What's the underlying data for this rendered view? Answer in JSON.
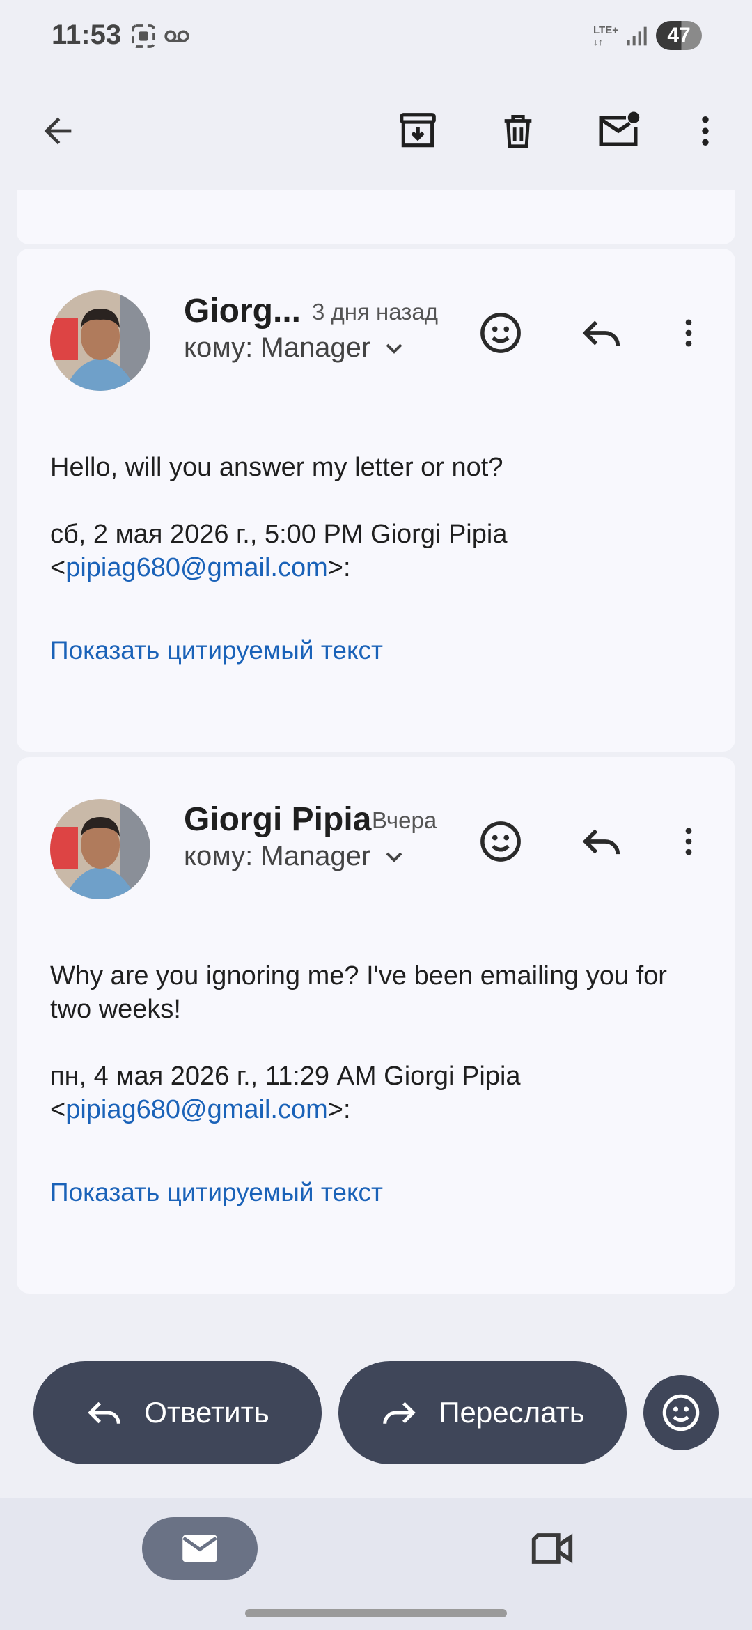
{
  "status_bar": {
    "time": "11:53",
    "network": "LTE+",
    "battery": "47"
  },
  "toolbar": {
    "icons": [
      "back-arrow-icon",
      "archive-icon",
      "trash-icon",
      "mark-unread-icon",
      "more-vert-icon"
    ]
  },
  "messages": [
    {
      "sender": "Giorg...",
      "time": "3 дня назад",
      "recipient": "кому: Manager",
      "body": "Hello, will you answer my letter or not?",
      "quote_header": "сб, 2 мая 2026 г., 5:00 PM Giorgi Pipia",
      "quote_email_prefix": "<",
      "quote_email": "pipiag680@gmail.com",
      "quote_email_suffix": ">:",
      "show_quoted": "Показать цитируемый текст"
    },
    {
      "sender": "Giorgi Pipia",
      "time": "Вчера",
      "recipient": "кому: Manager",
      "body": "Why are you ignoring me? I've been emailing you for two weeks!",
      "quote_header": "пн, 4 мая 2026 г., 11:29 AM Giorgi Pipia",
      "quote_email_prefix": "<",
      "quote_email": "pipiag680@gmail.com",
      "quote_email_suffix": ">:",
      "show_quoted": "Показать цитируемый текст"
    }
  ],
  "actions": {
    "reply": "Ответить",
    "forward": "Переслать"
  },
  "colors": {
    "accent": "#1a62b8",
    "button": "#3f4659",
    "card": "#f8f8fd",
    "background": "#eeeff5"
  }
}
